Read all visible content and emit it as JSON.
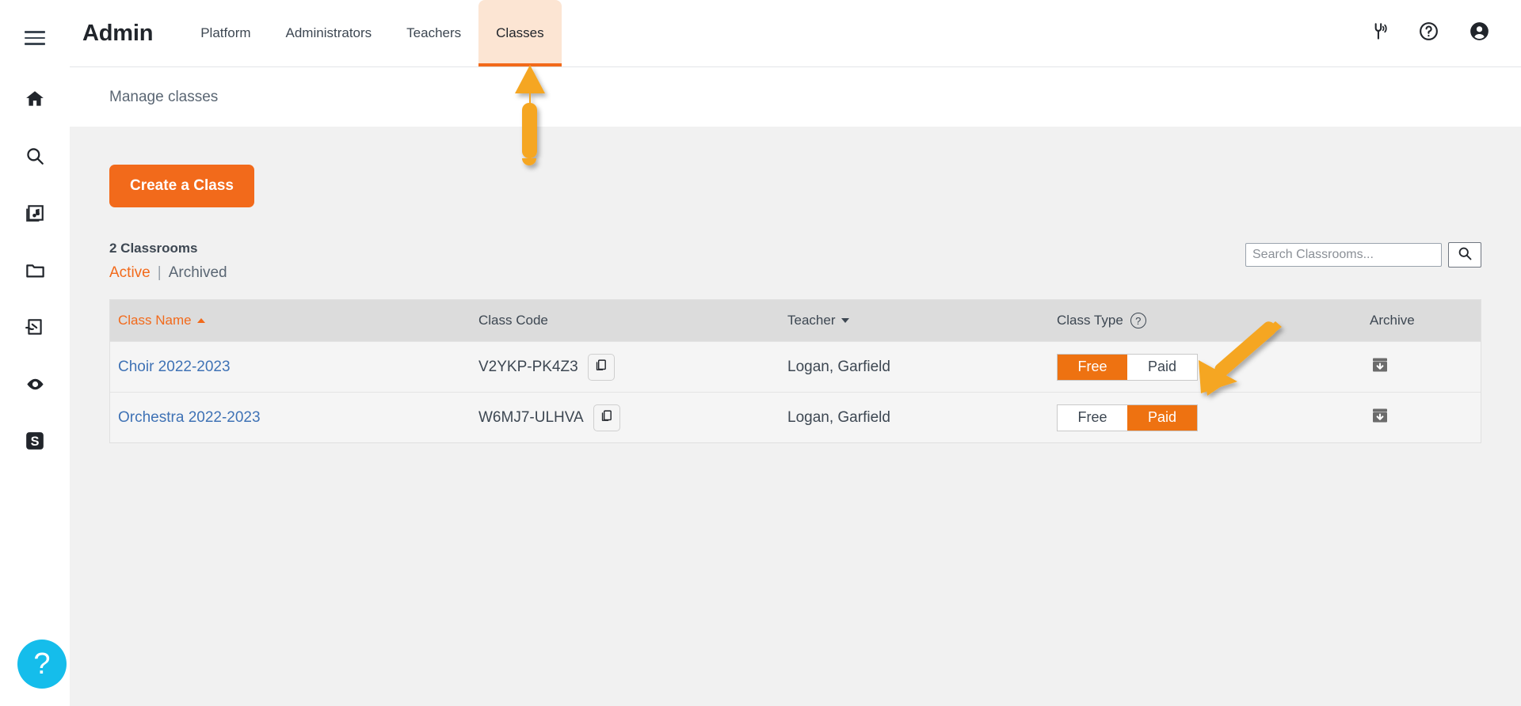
{
  "brand": {
    "title": "Admin"
  },
  "colors": {
    "accent_orange": "#f26a1b",
    "tab_highlight": "#fce5d3",
    "toggle_orange": "#ee7211",
    "link_blue": "#3f72b5",
    "help_cyan": "#15bdeb",
    "annotation_yellow": "#f5a623",
    "content_bg": "#f1f1f1",
    "table_header_bg": "#dcdcdc"
  },
  "rail": {
    "menu_label": "menu",
    "items": [
      {
        "icon": "home-icon",
        "label": "Home"
      },
      {
        "icon": "search-icon",
        "label": "Search"
      },
      {
        "icon": "music-library-icon",
        "label": "Music Library"
      },
      {
        "icon": "folder-icon",
        "label": "Folders"
      },
      {
        "icon": "compose-icon",
        "label": "Compose"
      },
      {
        "icon": "eye-icon",
        "label": "Preview"
      },
      {
        "icon": "s-badge-icon",
        "label": "S"
      }
    ],
    "help_glyph": "?"
  },
  "nav": {
    "tabs": [
      {
        "label": "Platform",
        "active": false
      },
      {
        "label": "Administrators",
        "active": false
      },
      {
        "label": "Teachers",
        "active": false
      },
      {
        "label": "Classes",
        "active": true
      }
    ]
  },
  "topbar_icons": [
    {
      "icon": "tuning-fork-icon",
      "label": "Tuner"
    },
    {
      "icon": "help-circle-icon",
      "label": "Help"
    },
    {
      "icon": "account-icon",
      "label": "Account"
    }
  ],
  "subheader": {
    "title": "Manage classes"
  },
  "actions": {
    "create_class_label": "Create a Class"
  },
  "list": {
    "count_label": "2 Classrooms",
    "filter_active": "Active",
    "filter_separator": "|",
    "filter_archived": "Archived"
  },
  "search": {
    "placeholder": "Search Classrooms...",
    "value": "",
    "button_icon": "search-icon"
  },
  "table": {
    "columns": [
      {
        "label": "Class Name",
        "sort": "asc",
        "sorted": true
      },
      {
        "label": "Class Code",
        "sort": "none",
        "sorted": false
      },
      {
        "label": "Teacher",
        "sort": "desc",
        "sorted": false
      },
      {
        "label": "Class Type",
        "sort": "none",
        "sorted": false,
        "info_glyph": "?"
      },
      {
        "label": "Archive",
        "sort": "none",
        "sorted": false
      }
    ],
    "toggle_options": {
      "free": "Free",
      "paid": "Paid"
    },
    "rows": [
      {
        "class_name": "Choir 2022-2023",
        "class_code": "V2YKP-PK4Z3",
        "teacher": "Logan, Garfield",
        "class_type": "Free"
      },
      {
        "class_name": "Orchestra 2022-2023",
        "class_code": "W6MJ7-ULHVA",
        "teacher": "Logan, Garfield",
        "class_type": "Paid"
      }
    ]
  },
  "annotations": [
    {
      "name": "arrow-pointing-to-classes-tab",
      "direction": "up"
    },
    {
      "name": "arrow-pointing-to-class-type-toggle",
      "direction": "down-left"
    }
  ]
}
